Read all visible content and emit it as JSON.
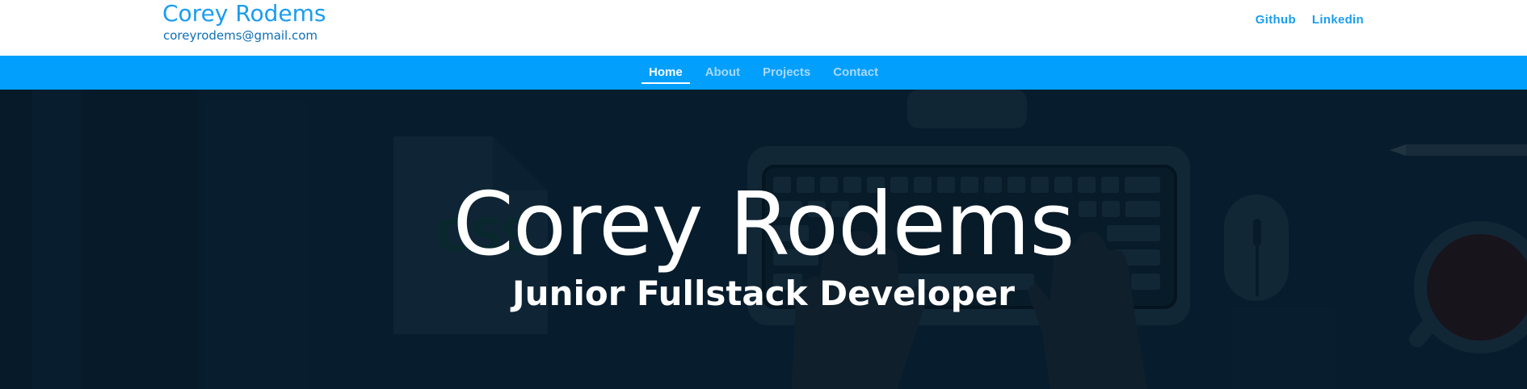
{
  "header": {
    "name": "Corey Rodems",
    "email": "coreyrodems@gmail.com",
    "links": [
      {
        "label": "Github"
      },
      {
        "label": "Linkedin"
      }
    ]
  },
  "nav": {
    "items": [
      {
        "label": "Home",
        "active": true
      },
      {
        "label": "About",
        "active": false
      },
      {
        "label": "Projects",
        "active": false
      },
      {
        "label": "Contact",
        "active": false
      }
    ]
  },
  "hero": {
    "title": "Corey Rodems",
    "subtitle": "Junior Fullstack Developer",
    "background_icons": [
      "keyboard-icon",
      "hands-icon",
      "mouse-icon",
      "coffee-cup-icon",
      "pencil-icon",
      "css-file-icon",
      "monitor-stand-icon"
    ]
  },
  "colors": {
    "accent": "#029ffd",
    "brand_text": "#1a9df0",
    "hero_background": "#0c2538",
    "nav_inactive": "#a9d9fb"
  }
}
